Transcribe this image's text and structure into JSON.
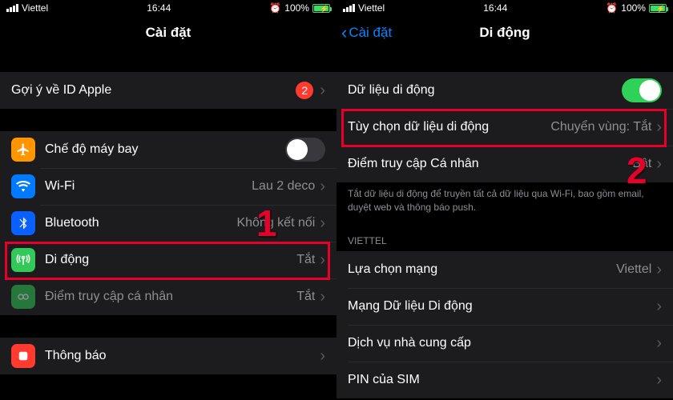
{
  "status": {
    "carrier": "Viettel",
    "time": "16:44",
    "battery_pct": "100%"
  },
  "left": {
    "title": "Cài đặt",
    "apple_id_suggest": "Gợi ý về ID Apple",
    "apple_id_badge": "2",
    "rows": {
      "airplane": "Chế độ máy bay",
      "wifi": "Wi-Fi",
      "wifi_val": "Lau 2 deco",
      "bluetooth": "Bluetooth",
      "bluetooth_val": "Không kết nối",
      "cellular": "Di động",
      "cellular_val": "Tắt",
      "hotspot": "Điểm truy cập cá nhân",
      "hotspot_val": "Tắt",
      "notifications": "Thông báo"
    }
  },
  "right": {
    "back": "Cài đặt",
    "title": "Di động",
    "rows": {
      "data": "Dữ liệu di động",
      "options": "Tùy chọn dữ liệu di động",
      "options_val": "Chuyển vùng: Tắt",
      "hotspot": "Điểm truy cập Cá nhân",
      "hotspot_val": "Bật",
      "note": "Tắt dữ liệu di động để truyền tất cả dữ liệu qua Wi-Fi, bao gồm email, duyệt web và thông báo push.",
      "carrier_header": "VIETTEL",
      "network_sel": "Lựa chọn mạng",
      "network_sel_val": "Viettel",
      "data_network": "Mạng Dữ liệu Di động",
      "carrier_services": "Dịch vụ nhà cung cấp",
      "sim_pin": "PIN của SIM"
    }
  },
  "callouts": {
    "one": "1",
    "two": "2"
  }
}
